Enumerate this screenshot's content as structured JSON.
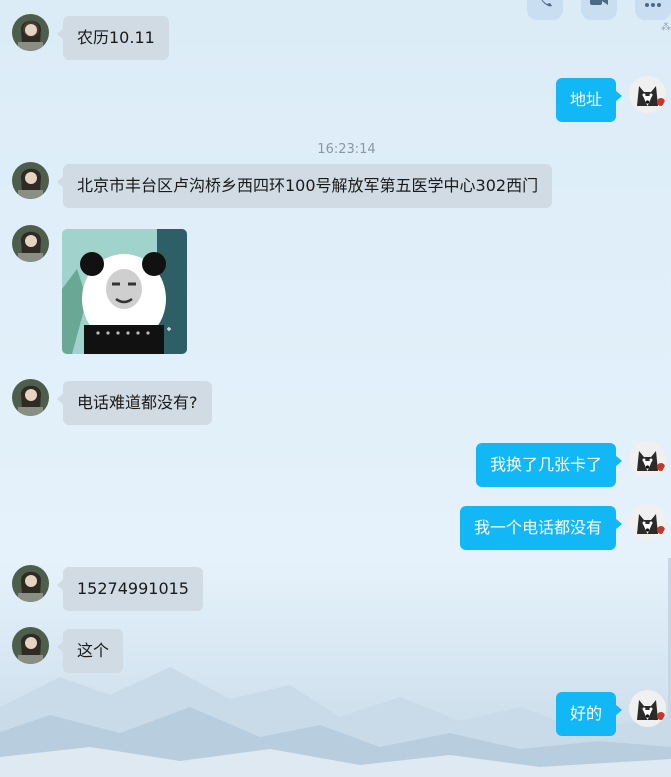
{
  "timestamp": "16:23:14",
  "messages": [
    {
      "id": "m1",
      "side": "left",
      "text": "农历10.11"
    },
    {
      "id": "m2",
      "side": "right",
      "text": "地址"
    },
    {
      "id": "m3",
      "side": "left",
      "text": "北京市丰台区卢沟桥乡西四环100号解放军第五医学中心302西门"
    },
    {
      "id": "m4",
      "side": "left",
      "type": "sticker",
      "icon": "panda-meme-sticker"
    },
    {
      "id": "m5",
      "side": "left",
      "text": "电话难道都没有?"
    },
    {
      "id": "m6",
      "side": "right",
      "text": "我换了几张卡了"
    },
    {
      "id": "m7",
      "side": "right",
      "text": "我一个电话都没有"
    },
    {
      "id": "m8",
      "side": "left",
      "text": "15274991015"
    },
    {
      "id": "m9",
      "side": "left",
      "text": "这个"
    },
    {
      "id": "m10",
      "side": "right",
      "text": "好的"
    }
  ],
  "top_toolbar": {
    "icons": [
      "phone-icon",
      "video-icon",
      "more-icon"
    ]
  },
  "colors": {
    "outgoing_bubble": "#12b7f5",
    "incoming_bubble": "#d0dbe3",
    "background": "#e2f0fa"
  }
}
